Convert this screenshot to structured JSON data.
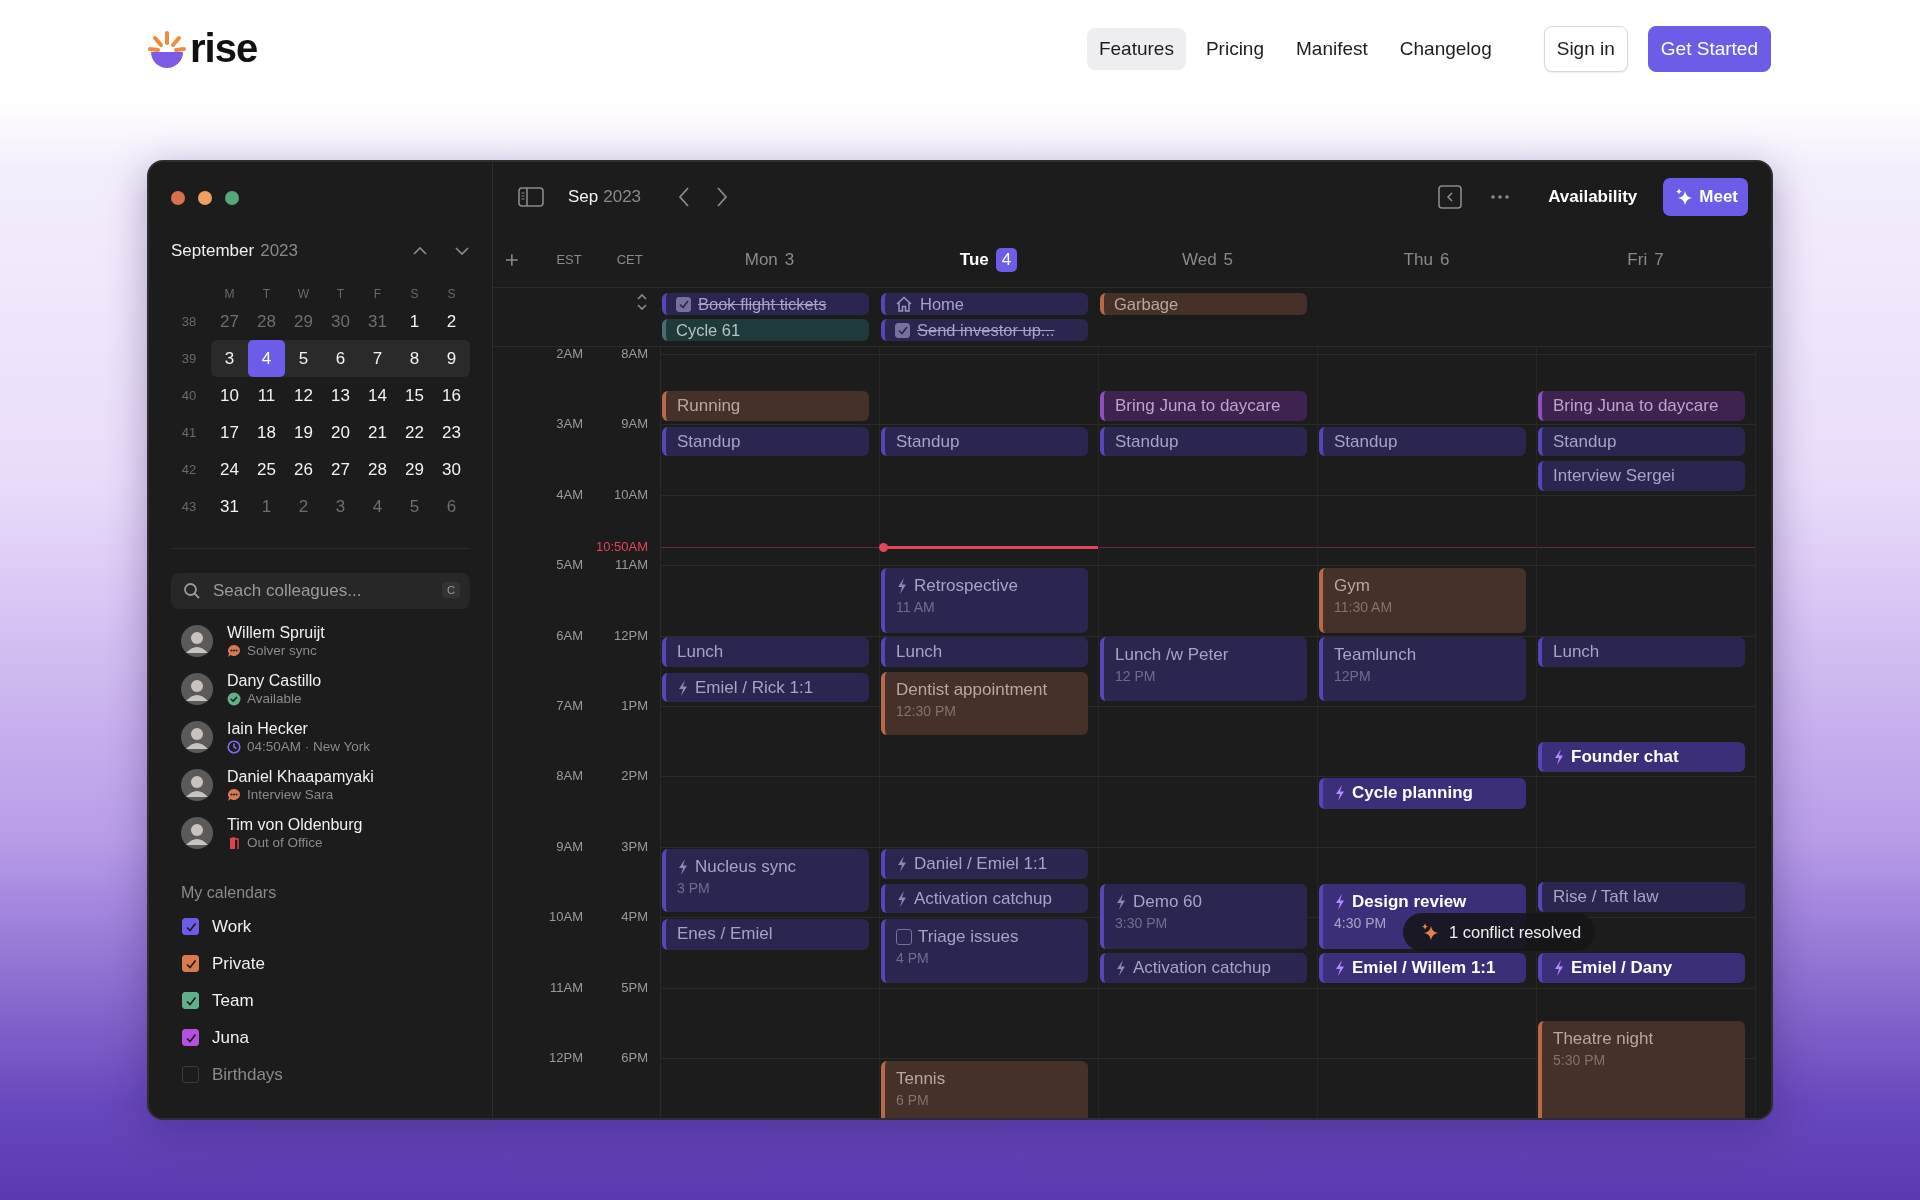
{
  "nav": {
    "logo": "rise",
    "links": [
      {
        "label": "Features",
        "selected": true
      },
      {
        "label": "Pricing",
        "selected": false
      },
      {
        "label": "Manifest",
        "selected": false
      },
      {
        "label": "Changelog",
        "selected": false
      }
    ],
    "actions": [
      {
        "label": "Sign in",
        "kind": "secondary"
      },
      {
        "label": "Get Started",
        "kind": "primary"
      }
    ]
  },
  "sidebar": {
    "month": "September",
    "year": "2023",
    "weekdays": [
      "M",
      "T",
      "W",
      "T",
      "F",
      "S",
      "S"
    ],
    "weeks": [
      {
        "number": "38",
        "days": [
          {
            "label": "27",
            "muted": true,
            "selected": false
          },
          {
            "label": "28",
            "muted": true,
            "selected": false
          },
          {
            "label": "29",
            "muted": true,
            "selected": false
          },
          {
            "label": "30",
            "muted": true,
            "selected": false
          },
          {
            "label": "31",
            "muted": true,
            "selected": false
          },
          {
            "label": "1",
            "muted": false,
            "selected": false
          },
          {
            "label": "2",
            "muted": false,
            "selected": false
          }
        ]
      },
      {
        "number": "39",
        "days": [
          {
            "label": "3",
            "muted": false,
            "selected": false
          },
          {
            "label": "4",
            "muted": false,
            "selected": true
          },
          {
            "label": "5",
            "muted": false,
            "selected": false
          },
          {
            "label": "6",
            "muted": false,
            "selected": false
          },
          {
            "label": "7",
            "muted": false,
            "selected": false
          },
          {
            "label": "8",
            "muted": false,
            "selected": false
          },
          {
            "label": "9",
            "muted": false,
            "selected": false
          }
        ]
      },
      {
        "number": "40",
        "days": [
          {
            "label": "10",
            "muted": false,
            "selected": false
          },
          {
            "label": "11",
            "muted": false,
            "selected": false
          },
          {
            "label": "12",
            "muted": false,
            "selected": false
          },
          {
            "label": "13",
            "muted": false,
            "selected": false
          },
          {
            "label": "14",
            "muted": false,
            "selected": false
          },
          {
            "label": "15",
            "muted": false,
            "selected": false
          },
          {
            "label": "16",
            "muted": false,
            "selected": false
          }
        ]
      },
      {
        "number": "41",
        "days": [
          {
            "label": "17",
            "muted": false,
            "selected": false
          },
          {
            "label": "18",
            "muted": false,
            "selected": false
          },
          {
            "label": "19",
            "muted": false,
            "selected": false
          },
          {
            "label": "20",
            "muted": false,
            "selected": false
          },
          {
            "label": "21",
            "muted": false,
            "selected": false
          },
          {
            "label": "22",
            "muted": false,
            "selected": false
          },
          {
            "label": "23",
            "muted": false,
            "selected": false
          }
        ]
      },
      {
        "number": "42",
        "days": [
          {
            "label": "24",
            "muted": false,
            "selected": false
          },
          {
            "label": "25",
            "muted": false,
            "selected": false
          },
          {
            "label": "26",
            "muted": false,
            "selected": false
          },
          {
            "label": "27",
            "muted": false,
            "selected": false
          },
          {
            "label": "28",
            "muted": false,
            "selected": false
          },
          {
            "label": "29",
            "muted": false,
            "selected": false
          },
          {
            "label": "30",
            "muted": false,
            "selected": false
          }
        ]
      },
      {
        "number": "43",
        "days": [
          {
            "label": "31",
            "muted": false,
            "selected": false
          },
          {
            "label": "1",
            "muted": true,
            "selected": false
          },
          {
            "label": "2",
            "muted": true,
            "selected": false
          },
          {
            "label": "3",
            "muted": true,
            "selected": false
          },
          {
            "label": "4",
            "muted": true,
            "selected": false
          },
          {
            "label": "5",
            "muted": true,
            "selected": false
          },
          {
            "label": "6",
            "muted": true,
            "selected": false
          }
        ]
      }
    ],
    "search": {
      "placeholder": "Seach colleagues...",
      "shortcut": "C"
    },
    "people": [
      {
        "name": "Willem Spruijt",
        "status": "Solver sync",
        "kind": "meeting"
      },
      {
        "name": "Dany Castillo",
        "status": "Available",
        "kind": "available"
      },
      {
        "name": "Iain Hecker",
        "status": "04:50AM · New York",
        "kind": "time"
      },
      {
        "name": "Daniel Khaapamyaki",
        "status": "Interview Sara",
        "kind": "meeting"
      },
      {
        "name": "Tim von Oldenburg",
        "status": "Out of Office",
        "kind": "away"
      }
    ],
    "calendars_title": "My calendars",
    "calendars": [
      {
        "label": "Work",
        "checked": true,
        "color": "#6c5ce7"
      },
      {
        "label": "Private",
        "checked": true,
        "color": "#d9794f"
      },
      {
        "label": "Team",
        "checked": true,
        "color": "#5fb08a"
      },
      {
        "label": "Juna",
        "checked": true,
        "color": "#b650e0"
      },
      {
        "label": "Birthdays",
        "checked": false
      }
    ]
  },
  "toolbar": {
    "month": "Sep",
    "year": "2023",
    "availability": "Availability",
    "meet": "Meet"
  },
  "timezones": [
    "EST",
    "CET"
  ],
  "hours": [
    {
      "est": "2AM",
      "cet": "8AM"
    },
    {
      "est": "3AM",
      "cet": "9AM"
    },
    {
      "est": "4AM",
      "cet": "10AM"
    },
    {
      "est": "5AM",
      "cet": "11AM"
    },
    {
      "est": "6AM",
      "cet": "12PM"
    },
    {
      "est": "7AM",
      "cet": "1PM"
    },
    {
      "est": "8AM",
      "cet": "2PM"
    },
    {
      "est": "9AM",
      "cet": "3PM"
    },
    {
      "est": "10AM",
      "cet": "4PM"
    },
    {
      "est": "11AM",
      "cet": "5PM"
    },
    {
      "est": "12PM",
      "cet": "6PM"
    }
  ],
  "now": "10:50AM",
  "days": [
    {
      "weekday": "Mon",
      "date": "3",
      "selected": false,
      "all_day": [
        {
          "title": "Book flight tickets",
          "kind": "task",
          "done": true,
          "color": "#5547b8"
        },
        {
          "title": "Cycle 61",
          "kind": "event",
          "color": "#4b6c72"
        }
      ],
      "events": [
        {
          "title": "Running",
          "kind": "event",
          "color": "#b86a48",
          "highlighted": false
        },
        {
          "title": "Standup",
          "kind": "event",
          "color": "#5547b8",
          "highlighted": false
        },
        {
          "title": "Lunch",
          "kind": "event",
          "color": "#5547b8",
          "highlighted": false
        },
        {
          "title": "Emiel / Rick 1:1",
          "kind": "focus",
          "color": "#5547b8",
          "highlighted": false
        },
        {
          "title": "Nucleus sync",
          "time": "3 PM",
          "kind": "focus",
          "color": "#5547b8",
          "highlighted": false
        },
        {
          "title": "Enes / Emiel",
          "kind": "event",
          "color": "#5547b8",
          "highlighted": false
        }
      ]
    },
    {
      "weekday": "Tue",
      "date": "4",
      "selected": true,
      "all_day": [
        {
          "title": "Home",
          "kind": "home",
          "color": "#5547b8"
        },
        {
          "title": "Send investor up...",
          "kind": "task",
          "done": true,
          "color": "#5547b8"
        }
      ],
      "events": [
        {
          "title": "Standup",
          "kind": "event",
          "color": "#5547b8",
          "highlighted": false
        },
        {
          "title": "Retrospective",
          "time": "11 AM",
          "kind": "focus",
          "color": "#5547b8",
          "highlighted": false
        },
        {
          "title": "Lunch",
          "kind": "event",
          "color": "#5547b8",
          "highlighted": false
        },
        {
          "title": "Dentist appointment",
          "time": "12:30 PM",
          "kind": "event",
          "color": "#b86a48",
          "highlighted": false
        },
        {
          "title": "Daniel / Emiel 1:1",
          "kind": "focus",
          "color": "#5547b8",
          "highlighted": false
        },
        {
          "title": "Activation catchup",
          "kind": "focus",
          "color": "#5547b8",
          "highlighted": false
        },
        {
          "title": "Triage issues",
          "time": "4 PM",
          "kind": "task",
          "done": false,
          "color": "#5547b8",
          "highlighted": false
        },
        {
          "title": "Tennis",
          "time": "6 PM",
          "kind": "event",
          "color": "#b86a48",
          "highlighted": false
        }
      ]
    },
    {
      "weekday": "Wed",
      "date": "5",
      "selected": false,
      "all_day": [
        {
          "title": "Garbage",
          "kind": "event",
          "color": "#b86a48"
        }
      ],
      "events": [
        {
          "title": "Bring Juna to daycare",
          "kind": "event",
          "color": "#8e4fc0",
          "highlighted": false
        },
        {
          "title": "Standup",
          "kind": "event",
          "color": "#5547b8",
          "highlighted": false
        },
        {
          "title": "Lunch /w Peter",
          "time": "12 PM",
          "kind": "event",
          "color": "#5547b8",
          "highlighted": false
        },
        {
          "title": "Demo 60",
          "time": "3:30 PM",
          "kind": "focus",
          "color": "#5547b8",
          "highlighted": false
        },
        {
          "title": "Activation catchup",
          "kind": "focus",
          "color": "#5547b8",
          "highlighted": false
        }
      ]
    },
    {
      "weekday": "Thu",
      "date": "6",
      "selected": false,
      "events": [
        {
          "title": "Standup",
          "kind": "event",
          "color": "#5547b8",
          "highlighted": false
        },
        {
          "title": "Gym",
          "time": "11:30 AM",
          "kind": "event",
          "color": "#b86a48",
          "highlighted": false
        },
        {
          "title": "Teamlunch",
          "time": "12PM",
          "kind": "event",
          "color": "#5547b8",
          "highlighted": false
        },
        {
          "title": "Cycle planning",
          "kind": "focus",
          "color": "#5547b8",
          "highlighted": true
        },
        {
          "title": "Design review",
          "time": "4:30 PM",
          "kind": "focus",
          "color": "#5547b8",
          "highlighted": true
        },
        {
          "title": "Emiel / Willem 1:1",
          "kind": "focus",
          "color": "#5547b8",
          "highlighted": true
        }
      ]
    },
    {
      "weekday": "Fri",
      "date": "7",
      "selected": false,
      "events": [
        {
          "title": "Bring Juna to daycare",
          "kind": "event",
          "color": "#8e4fc0",
          "highlighted": false
        },
        {
          "title": "Standup",
          "kind": "event",
          "color": "#5547b8",
          "highlighted": false
        },
        {
          "title": "Interview Sergei",
          "kind": "event",
          "color": "#5547b8",
          "highlighted": false
        },
        {
          "title": "Lunch",
          "kind": "event",
          "color": "#5547b8",
          "highlighted": false
        },
        {
          "title": "Founder chat",
          "kind": "focus",
          "color": "#5547b8",
          "highlighted": true
        },
        {
          "title": "Rise / Taft law",
          "kind": "event",
          "color": "#5547b8",
          "highlighted": false
        },
        {
          "title": "Emiel / Dany",
          "kind": "focus",
          "color": "#5547b8",
          "highlighted": true
        },
        {
          "title": "Theatre night",
          "time": "5:30 PM",
          "kind": "event",
          "color": "#b86a48",
          "highlighted": false
        }
      ]
    }
  ],
  "toast": "1 conflict resolved"
}
